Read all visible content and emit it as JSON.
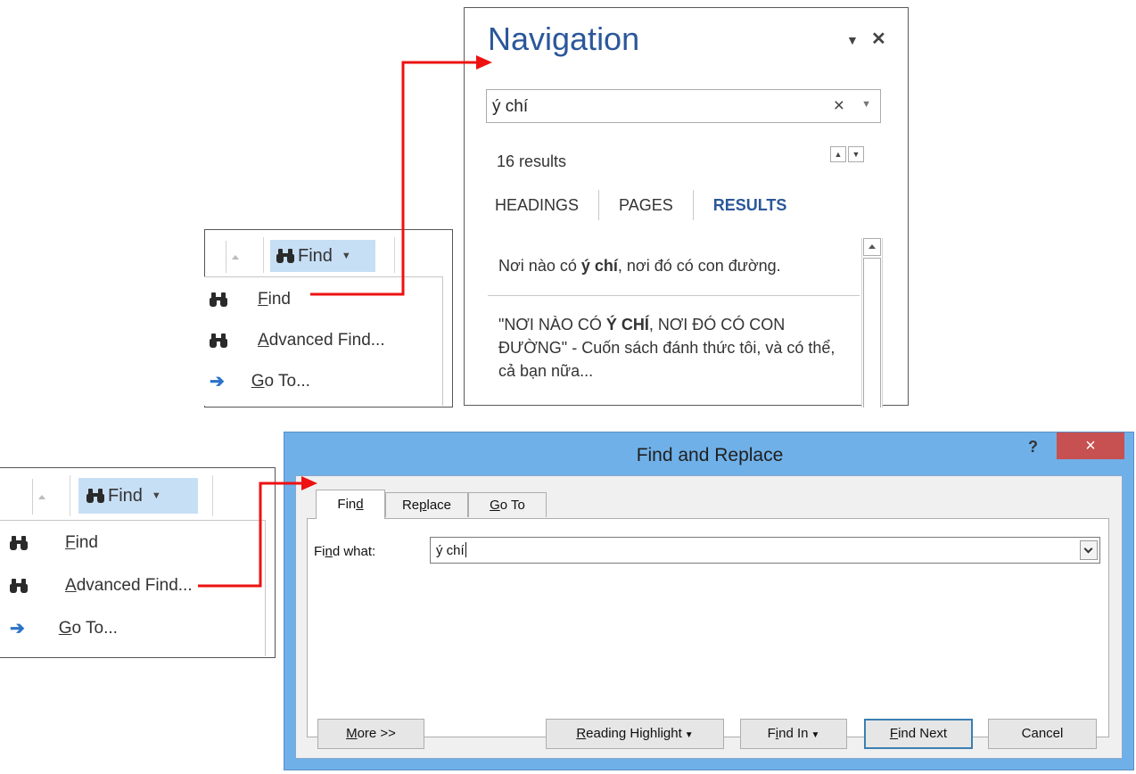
{
  "ribbon_menu_top": {
    "button_label": "Find",
    "items": [
      {
        "icon": "binoculars-icon",
        "label": "Find",
        "mnemonic": "F",
        "rest": "ind"
      },
      {
        "icon": "binoculars-icon",
        "label": "Advanced Find...",
        "mnemonic": "A",
        "rest": "dvanced Find..."
      },
      {
        "icon": "arrow-right-icon",
        "label": "Go To...",
        "mnemonic": "G",
        "rest": "o To..."
      }
    ]
  },
  "ribbon_menu_bottom": {
    "button_label": "Find",
    "items": [
      {
        "icon": "binoculars-icon",
        "label": "Find",
        "mnemonic": "F",
        "rest": "ind"
      },
      {
        "icon": "binoculars-icon",
        "label": "Advanced Find...",
        "mnemonic": "A",
        "rest": "dvanced Find..."
      },
      {
        "icon": "arrow-right-icon",
        "label": "Go To...",
        "mnemonic": "G",
        "rest": "o To..."
      }
    ]
  },
  "navigation": {
    "title": "Navigation",
    "search_value": "ý chí",
    "clear_symbol": "×",
    "results_count": "16 results",
    "tabs": [
      "HEADINGS",
      "PAGES",
      "RESULTS"
    ],
    "active_tab": "RESULTS",
    "results": [
      {
        "before": "Nơi nào có ",
        "bold": "ý chí",
        "after": ", nơi đó có con đường."
      },
      {
        "before": "\"NƠI NÀO CÓ ",
        "bold": "Ý CHÍ",
        "after": ", NƠI ĐÓ CÓ CON ĐƯỜNG\" - Cuốn sách đánh thức tôi, và có thể, cả bạn nữa..."
      }
    ],
    "accent_color": "#2b579a"
  },
  "dialog": {
    "title": "Find and Replace",
    "help": "?",
    "close": "×",
    "tabs": [
      {
        "pre": "Fin",
        "mn": "d",
        "post": ""
      },
      {
        "pre": "Re",
        "mn": "p",
        "post": "lace"
      },
      {
        "pre": "",
        "mn": "G",
        "post": "o To"
      }
    ],
    "find_what_label": {
      "pre": "Fi",
      "mn": "n",
      "post": "d what:"
    },
    "find_what_value": "ý chí",
    "buttons": {
      "more": {
        "pre": "",
        "mn": "M",
        "post": "ore >>"
      },
      "reading_highlight": {
        "pre": "",
        "mn": "R",
        "post": "eading Highlight"
      },
      "find_in": {
        "pre": "F",
        "mn": "i",
        "post": "nd In"
      },
      "find_next": {
        "pre": "",
        "mn": "F",
        "post": "ind Next"
      },
      "cancel": "Cancel"
    },
    "title_bar_color": "#6fb0e8",
    "close_color": "#c75050"
  },
  "annotation_color": "#ee1111"
}
